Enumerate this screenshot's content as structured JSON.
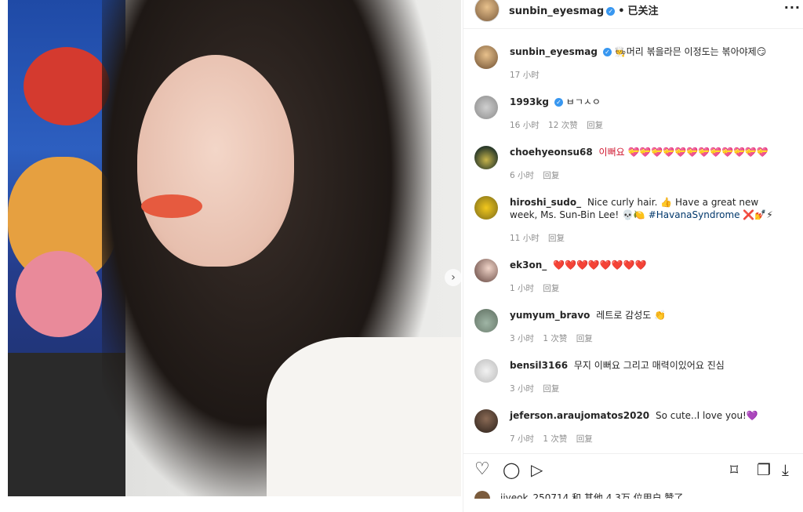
{
  "post": {
    "author": "sunbin_eyesmag",
    "follow_status": "已关注",
    "dot": "•",
    "more": "···",
    "next_icon": "›"
  },
  "caption": {
    "username": "sunbin_eyesmag",
    "text": "🧑‍🍳머리 볶을라믄 이정도는 볶아야제😏",
    "time": "17 小时"
  },
  "comments": [
    {
      "username": "1993kg",
      "verified": true,
      "text": "ㅂㄱㅅㅇ",
      "time": "16 小时",
      "likes": "12 次赞",
      "reply": "回复"
    },
    {
      "username": "choehyeonsu68",
      "verified": false,
      "text": "이뻐요 💝💝💝💝💝💝💝💝💝💝💝💝",
      "time": "6 小时",
      "likes": "",
      "reply": "回复"
    },
    {
      "username": "hiroshi_sudo_",
      "verified": false,
      "text": "Nice curly hair. 👍 Have a great new week, Ms. Sun-Bin Lee! 💀🍋",
      "hashtag": "#HavanaSyndrome",
      "text_after": "❌💅⚡",
      "time": "11 小时",
      "likes": "",
      "reply": "回复"
    },
    {
      "username": "ek3on_",
      "verified": false,
      "text": "❤️❤️❤️❤️❤️❤️❤️❤️",
      "time": "1 小时",
      "likes": "",
      "reply": "回复"
    },
    {
      "username": "yumyum_bravo",
      "verified": false,
      "text": "레트로 감성도 👏",
      "time": "3 小时",
      "likes": "1 次赞",
      "reply": "回复"
    },
    {
      "username": "bensil3166",
      "verified": false,
      "text": "무지 이뻐요 그리고 매력이있어요 진심",
      "time": "3 小时",
      "likes": "",
      "reply": "回复"
    },
    {
      "username": "jeferson.araujomatos2020",
      "verified": false,
      "text": "So cute..I love you!💜",
      "time": "7 小时",
      "likes": "1 次赞",
      "reply": "回复"
    }
  ],
  "actions": {
    "like_icon": "♡",
    "comment_icon": "◯",
    "share_icon": "▷",
    "save_icon": "⌑",
    "copy_icon": "❐",
    "download_icon": "⤓"
  },
  "likes_line": "jiyeok_250714 和 其他 4.3万 位用户 赞了"
}
